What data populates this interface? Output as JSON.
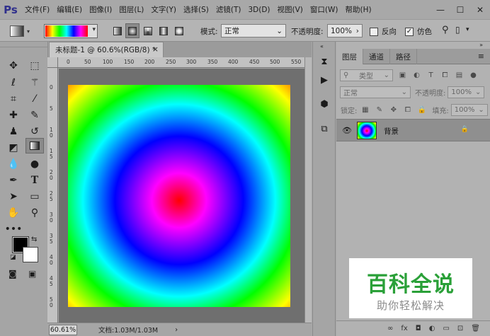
{
  "app": {
    "logo": "Ps"
  },
  "menu": [
    "文件(F)",
    "编辑(E)",
    "图像(I)",
    "图层(L)",
    "文字(Y)",
    "选择(S)",
    "滤镜(T)",
    "3D(D)",
    "视图(V)",
    "窗口(W)",
    "帮助(H)"
  ],
  "window_buttons": {
    "minimize": "—",
    "maximize": "☐",
    "close": "✕"
  },
  "options": {
    "mode_label": "模式:",
    "mode_value": "正常",
    "opacity_label": "不透明度:",
    "opacity_value": "100%",
    "reverse_label": "反向",
    "dither_label": "仿色",
    "reverse_checked": false,
    "dither_checked": true
  },
  "document": {
    "tab_title": "未标题-1 @ 60.6%(RGB/8) *",
    "close": "×",
    "ruler_h": [
      "0",
      "50",
      "100",
      "150",
      "200",
      "250",
      "300",
      "350",
      "400",
      "450",
      "500",
      "550",
      "600"
    ],
    "ruler_v": [
      "0",
      "5",
      "1\n0",
      "1\n5",
      "2\n0",
      "2\n5",
      "3\n0",
      "3\n5",
      "4\n0",
      "4\n5",
      "5\n0"
    ]
  },
  "status": {
    "zoom": "60.61%",
    "doc_info": "文档:1.03M/1.03M",
    "arrow": "›"
  },
  "layers_panel": {
    "tabs": [
      "图层",
      "通道",
      "路径"
    ],
    "menu_icon": "≡",
    "filter_kind": "类型",
    "blend_mode": "正常",
    "opacity_label": "不透明度:",
    "opacity_value": "100%",
    "lock_label": "锁定:",
    "fill_label": "填充:",
    "fill_value": "100%",
    "layer_name": "背景",
    "bottom_icons": [
      "∞",
      "fx",
      "◘",
      "◐",
      "▭",
      "⊡",
      "🗑"
    ]
  },
  "watermark": {
    "title": "百科全说",
    "subtitle": "助你轻松解决"
  },
  "colors": {
    "foreground": "#000000",
    "background": "#ffffff",
    "watermark_green": "#2aa038"
  },
  "icons": {
    "tools": [
      "move-icon",
      "marquee-icon",
      "lasso-icon",
      "magic-wand-icon",
      "crop-icon",
      "eyedropper-icon",
      "healing-icon",
      "brush-icon",
      "stamp-icon",
      "history-brush-icon",
      "eraser-icon",
      "gradient-icon",
      "blur-icon",
      "dodge-icon",
      "pen-icon",
      "type-icon",
      "path-select-icon",
      "rectangle-icon",
      "hand-icon",
      "zoom-icon",
      "more-icon"
    ]
  }
}
